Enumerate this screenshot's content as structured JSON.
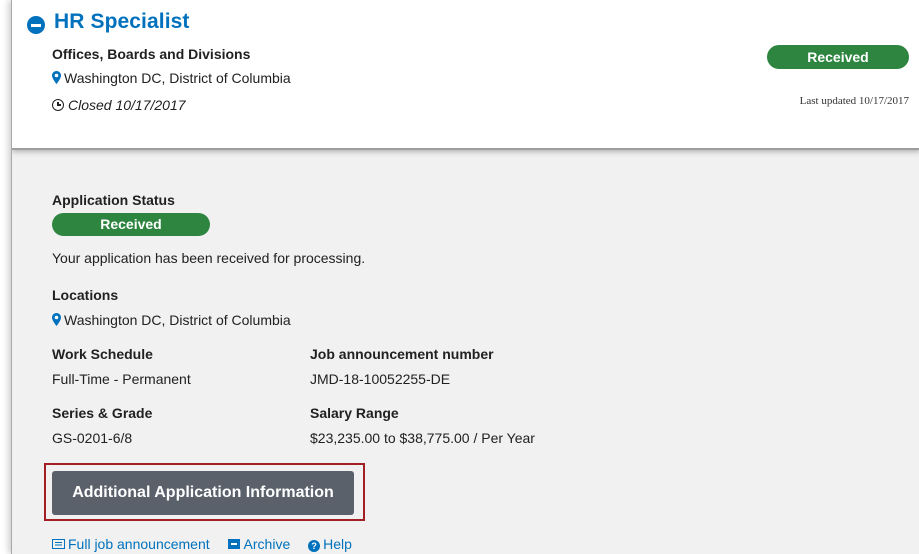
{
  "job": {
    "title": "HR Specialist",
    "organization": "Offices, Boards and Divisions",
    "location": "Washington DC, District of Columbia",
    "closed": "Closed 10/17/2017",
    "status_badge": "Received",
    "last_updated": "Last updated 10/17/2017"
  },
  "details": {
    "application_status_label": "Application Status",
    "application_status_value": "Received",
    "status_message": "Your application has been received for processing.",
    "locations_label": "Locations",
    "locations_value": "Washington DC, District of Columbia",
    "work_schedule_label": "Work Schedule",
    "work_schedule_value": "Full-Time - Permanent",
    "announcement_label": "Job announcement number",
    "announcement_value": "JMD-18-10052255-DE",
    "series_grade_label": "Series & Grade",
    "series_grade_value": "GS-0201-6/8",
    "salary_label": "Salary Range",
    "salary_value": "$23,235.00 to $38,775.00 / Per Year"
  },
  "actions": {
    "additional_info_button": "Additional Application Information",
    "full_announcement_link": "Full job announcement",
    "archive_link": "Archive",
    "help_link": "Help"
  },
  "colors": {
    "link_blue": "#0071bc",
    "status_green": "#2e8540",
    "button_gray": "#5b616b",
    "highlight_red": "#a31f24"
  },
  "icons": {
    "collapse": "minus-circle-icon",
    "location": "map-pin-icon",
    "closed": "clock-icon",
    "full_announcement": "document-list-icon",
    "archive": "archive-box-icon",
    "help": "question-circle-icon"
  }
}
